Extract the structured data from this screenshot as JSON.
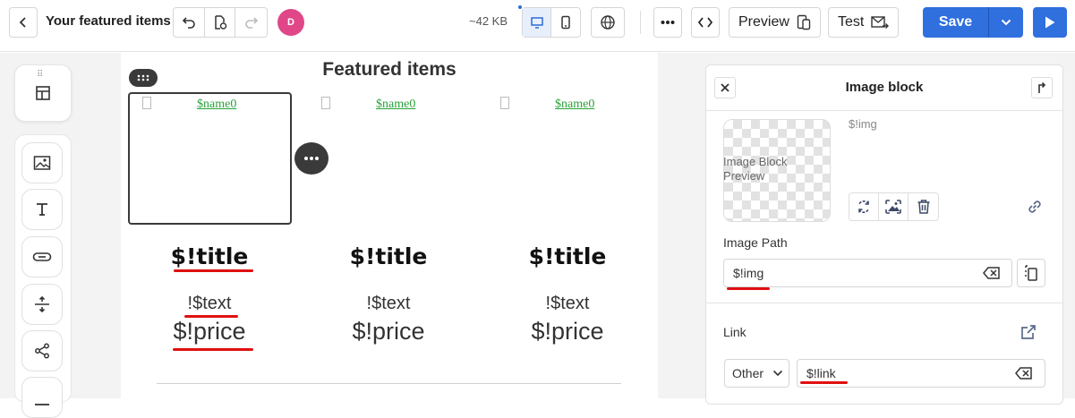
{
  "header": {
    "title": "Your featured items",
    "avatar_initial": "D",
    "size": "~42 KB",
    "preview_label": "Preview",
    "test_label": "Test",
    "save_label": "Save"
  },
  "canvas": {
    "title": "Featured items",
    "products": [
      {
        "name": "$name0",
        "title": "$!title",
        "text": "!$text",
        "price": "$!price"
      },
      {
        "name": "$name0",
        "title": "$!title",
        "text": "!$text",
        "price": "$!price"
      },
      {
        "name": "$name0",
        "title": "$!title",
        "text": "!$text",
        "price": "$!price"
      }
    ]
  },
  "panel": {
    "title": "Image block",
    "preview_alt": "Image Block Preview",
    "img_var": "$!img",
    "image_path_label": "Image Path",
    "image_path_value": "$!img",
    "link_label": "Link",
    "link_type": "Other",
    "link_value": "$!link"
  },
  "colors": {
    "accent": "#2f6fde",
    "avatar": "#e04788",
    "link_green": "#2aa33a",
    "annotation_red": "#e01010"
  }
}
